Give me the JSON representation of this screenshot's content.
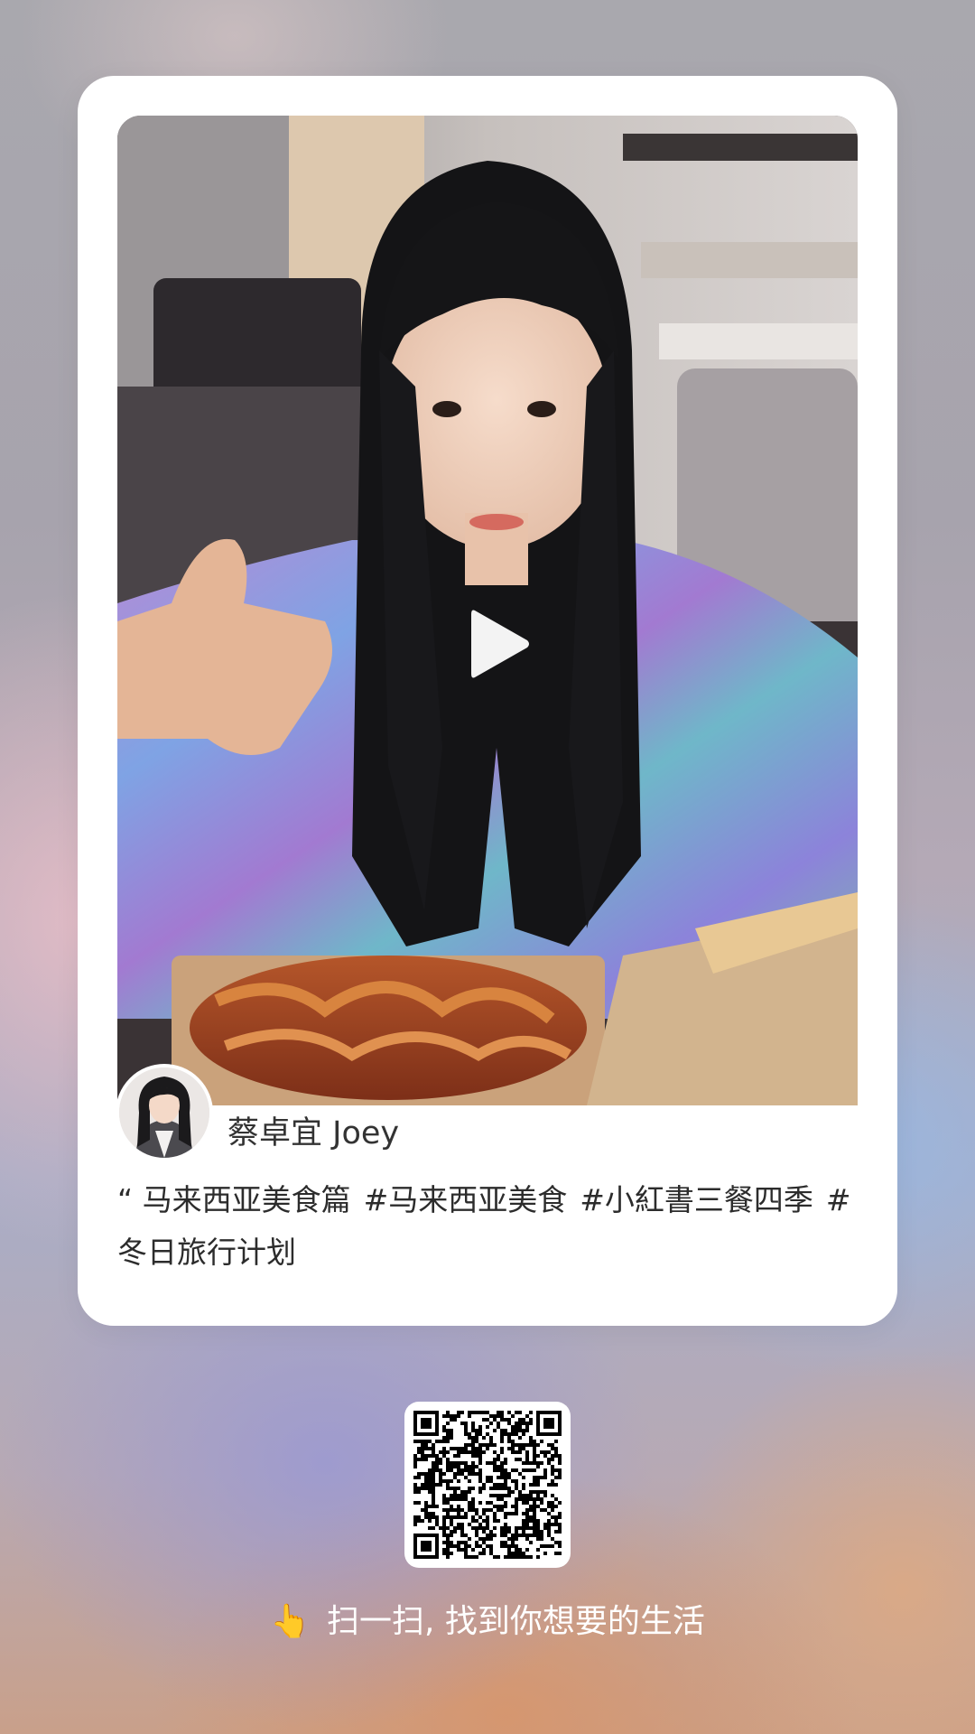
{
  "post": {
    "author_name": "蔡卓宜 Joey",
    "caption_prefix": "“ 马来西亚美食篇",
    "hashtags": [
      "#马来西亚美食",
      "#小紅書三餐四季",
      "#冬日旅行计划"
    ],
    "media_type": "video"
  },
  "footer": {
    "hand_emoji": "👆",
    "scan_text": "扫一扫, 找到你想要的生活"
  },
  "icons": {
    "play": "play-icon",
    "qr": "qr-code"
  },
  "colors": {
    "card": "#ffffff",
    "text": "#333333",
    "footer_text": "#ffffff"
  }
}
